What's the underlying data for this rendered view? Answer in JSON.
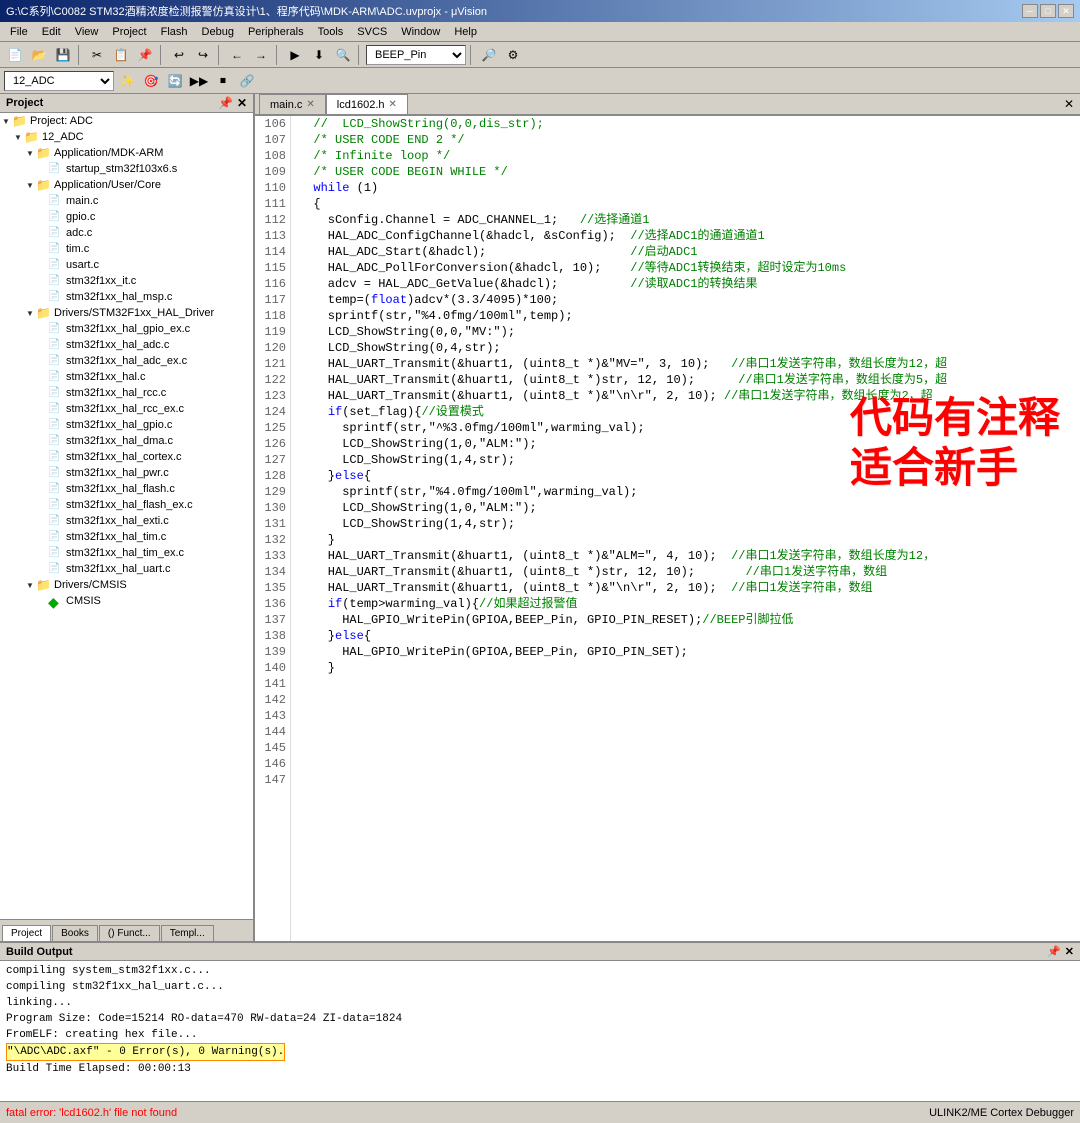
{
  "titlebar": {
    "title": "G:\\C系列\\C0082 STM32酒精浓度检测报警仿真设计\\1、程序代码\\MDK-ARM\\ADC.uvprojx - μVision",
    "minimize": "─",
    "maximize": "□",
    "close": "✕"
  },
  "menubar": {
    "items": [
      "File",
      "Edit",
      "View",
      "Project",
      "Flash",
      "Debug",
      "Peripherals",
      "Tools",
      "SVCS",
      "Window",
      "Help"
    ]
  },
  "toolbar1": {
    "dropdown_value": "12_ADC",
    "target_dropdown": "BEEP_Pin"
  },
  "project_panel": {
    "title": "Project",
    "root": "Project: ADC",
    "tree": [
      {
        "label": "Project: ADC",
        "level": 0,
        "type": "root",
        "expanded": true
      },
      {
        "label": "12_ADC",
        "level": 1,
        "type": "folder",
        "expanded": true
      },
      {
        "label": "Application/MDK-ARM",
        "level": 2,
        "type": "folder",
        "expanded": true
      },
      {
        "label": "startup_stm32f103x6.s",
        "level": 3,
        "type": "file"
      },
      {
        "label": "Application/User/Core",
        "level": 2,
        "type": "folder",
        "expanded": true
      },
      {
        "label": "main.c",
        "level": 3,
        "type": "file"
      },
      {
        "label": "gpio.c",
        "level": 3,
        "type": "file"
      },
      {
        "label": "adc.c",
        "level": 3,
        "type": "file"
      },
      {
        "label": "tim.c",
        "level": 3,
        "type": "file"
      },
      {
        "label": "usart.c",
        "level": 3,
        "type": "file"
      },
      {
        "label": "stm32f1xx_it.c",
        "level": 3,
        "type": "file"
      },
      {
        "label": "stm32f1xx_hal_msp.c",
        "level": 3,
        "type": "file"
      },
      {
        "label": "Drivers/STM32F1xx_HAL_Driver",
        "level": 2,
        "type": "folder",
        "expanded": true
      },
      {
        "label": "stm32f1xx_hal_gpio_ex.c",
        "level": 3,
        "type": "file"
      },
      {
        "label": "stm32f1xx_hal_adc.c",
        "level": 3,
        "type": "file"
      },
      {
        "label": "stm32f1xx_hal_adc_ex.c",
        "level": 3,
        "type": "file"
      },
      {
        "label": "stm32f1xx_hal.c",
        "level": 3,
        "type": "file"
      },
      {
        "label": "stm32f1xx_hal_rcc.c",
        "level": 3,
        "type": "file"
      },
      {
        "label": "stm32f1xx_hal_rcc_ex.c",
        "level": 3,
        "type": "file"
      },
      {
        "label": "stm32f1xx_hal_gpio.c",
        "level": 3,
        "type": "file"
      },
      {
        "label": "stm32f1xx_hal_dma.c",
        "level": 3,
        "type": "file"
      },
      {
        "label": "stm32f1xx_hal_cortex.c",
        "level": 3,
        "type": "file"
      },
      {
        "label": "stm32f1xx_hal_pwr.c",
        "level": 3,
        "type": "file"
      },
      {
        "label": "stm32f1xx_hal_flash.c",
        "level": 3,
        "type": "file"
      },
      {
        "label": "stm32f1xx_hal_flash_ex.c",
        "level": 3,
        "type": "file"
      },
      {
        "label": "stm32f1xx_hal_exti.c",
        "level": 3,
        "type": "file"
      },
      {
        "label": "stm32f1xx_hal_tim.c",
        "level": 3,
        "type": "file"
      },
      {
        "label": "stm32f1xx_hal_tim_ex.c",
        "level": 3,
        "type": "file"
      },
      {
        "label": "stm32f1xx_hal_uart.c",
        "level": 3,
        "type": "file"
      },
      {
        "label": "Drivers/CMSIS",
        "level": 2,
        "type": "folder",
        "expanded": true
      },
      {
        "label": "CMSIS",
        "level": 3,
        "type": "diamond"
      }
    ],
    "tabs": [
      {
        "label": "Project",
        "icon": "📋",
        "active": true
      },
      {
        "label": "Books",
        "icon": "📚",
        "active": false
      },
      {
        "label": "() Funct...",
        "icon": "",
        "active": false
      },
      {
        "label": "Templ...",
        "icon": "",
        "active": false
      }
    ]
  },
  "editor": {
    "tabs": [
      {
        "label": "main.c",
        "active": false
      },
      {
        "label": "lcd1602.h",
        "active": true
      }
    ],
    "lines": [
      {
        "num": 106,
        "text": "  //  LCD_ShowString(0,0,dis_str);"
      },
      {
        "num": 107,
        "text": "  /* USER CODE END 2 */"
      },
      {
        "num": 108,
        "text": ""
      },
      {
        "num": 109,
        "text": "  /* Infinite loop */"
      },
      {
        "num": 110,
        "text": "  /* USER CODE BEGIN WHILE */"
      },
      {
        "num": 111,
        "text": "  while (1)"
      },
      {
        "num": 112,
        "text": "  {"
      },
      {
        "num": 113,
        "text": "    sConfig.Channel = ADC_CHANNEL_1;   //选择通道1"
      },
      {
        "num": 114,
        "text": "    HAL_ADC_ConfigChannel(&hadcl, &sConfig);  //选择ADC1的通道通道1"
      },
      {
        "num": 115,
        "text": "    HAL_ADC_Start(&hadcl);                    //启动ADC1"
      },
      {
        "num": 116,
        "text": "    HAL_ADC_PollForConversion(&hadcl, 10);    //等待ADC1转换结束，超时设定为10ms"
      },
      {
        "num": 117,
        "text": "    adcv = HAL_ADC_GetValue(&hadcl);          //读取ADC1的转换结果"
      },
      {
        "num": 118,
        "text": ""
      },
      {
        "num": 119,
        "text": ""
      },
      {
        "num": 120,
        "text": "    temp=(float)adcv*(3.3/4095)*100;"
      },
      {
        "num": 121,
        "text": ""
      },
      {
        "num": 122,
        "text": "    sprintf(str,\"%4.0fmg/100ml\",temp);"
      },
      {
        "num": 123,
        "text": "    LCD_ShowString(0,0,\"MV:\");"
      },
      {
        "num": 124,
        "text": "    LCD_ShowString(0,4,str);"
      },
      {
        "num": 125,
        "text": "    HAL_UART_Transmit(&huart1, (uint8_t *)&\"MV=\", 3, 10);   //串口1发送字符串，数组长度为12，超"
      },
      {
        "num": 126,
        "text": "    HAL_UART_Transmit(&huart1, (uint8_t *)str, 12, 10);      //串口1发送字符串，数组长度为5，超"
      },
      {
        "num": 127,
        "text": "    HAL_UART_Transmit(&huart1, (uint8_t *)&\"\\n\\r\", 2, 10); //串口1发送字符串，数组长度为2，超"
      },
      {
        "num": 128,
        "text": ""
      },
      {
        "num": 129,
        "text": "    if(set_flag){//设置模式"
      },
      {
        "num": 130,
        "text": "      sprintf(str,\"^%3.0fmg/100ml\",warming_val);"
      },
      {
        "num": 131,
        "text": "      LCD_ShowString(1,0,\"ALM:\");"
      },
      {
        "num": 132,
        "text": "      LCD_ShowString(1,4,str);"
      },
      {
        "num": 133,
        "text": "    }else{"
      },
      {
        "num": 134,
        "text": "      sprintf(str,\"%4.0fmg/100ml\",warming_val);"
      },
      {
        "num": 135,
        "text": "      LCD_ShowString(1,0,\"ALM:\");"
      },
      {
        "num": 136,
        "text": "      LCD_ShowString(1,4,str);"
      },
      {
        "num": 137,
        "text": "    }"
      },
      {
        "num": 138,
        "text": ""
      },
      {
        "num": 139,
        "text": "    HAL_UART_Transmit(&huart1, (uint8_t *)&\"ALM=\", 4, 10);  //串口1发送字符串，数组长度为12，"
      },
      {
        "num": 140,
        "text": "    HAL_UART_Transmit(&huart1, (uint8_t *)str, 12, 10);       //串口1发送字符串，数组"
      },
      {
        "num": 141,
        "text": "    HAL_UART_Transmit(&huart1, (uint8_t *)&\"\\n\\r\", 2, 10);  //串口1发送字符串，数组"
      },
      {
        "num": 142,
        "text": ""
      },
      {
        "num": 143,
        "text": "    if(temp>warming_val){//如果超过报警值"
      },
      {
        "num": 144,
        "text": "      HAL_GPIO_WritePin(GPIOA,BEEP_Pin, GPIO_PIN_RESET);//BEEP引脚拉低"
      },
      {
        "num": 145,
        "text": "    }else{"
      },
      {
        "num": 146,
        "text": "      HAL_GPIO_WritePin(GPIOA,BEEP_Pin, GPIO_PIN_SET);"
      },
      {
        "num": 147,
        "text": "    }"
      }
    ]
  },
  "overlay": {
    "line1": "代码有注释",
    "line2": "适合新手"
  },
  "build_output": {
    "title": "Build Output",
    "lines": [
      "compiling system_stm32f1xx.c...",
      "compiling stm32f1xx_hal_uart.c...",
      "linking...",
      "",
      "Program Size: Code=15214 RO-data=470 RW-data=24 ZI-data=1824",
      "",
      "FromELF: creating hex file...",
      "\"\\ADC\\ADC.axf\" - 0 Error(s), 0 Warning(s).",
      "Build Time Elapsed: 00:00:13"
    ],
    "highlight_line": "\"\\ADC\\ADC.axf\" - 0 Error(s), 0 Warning(s)."
  },
  "statusbar": {
    "error_text": "fatal error: 'lcd1602.h' file not found",
    "debugger": "ULINK2/ME Cortex Debugger"
  }
}
